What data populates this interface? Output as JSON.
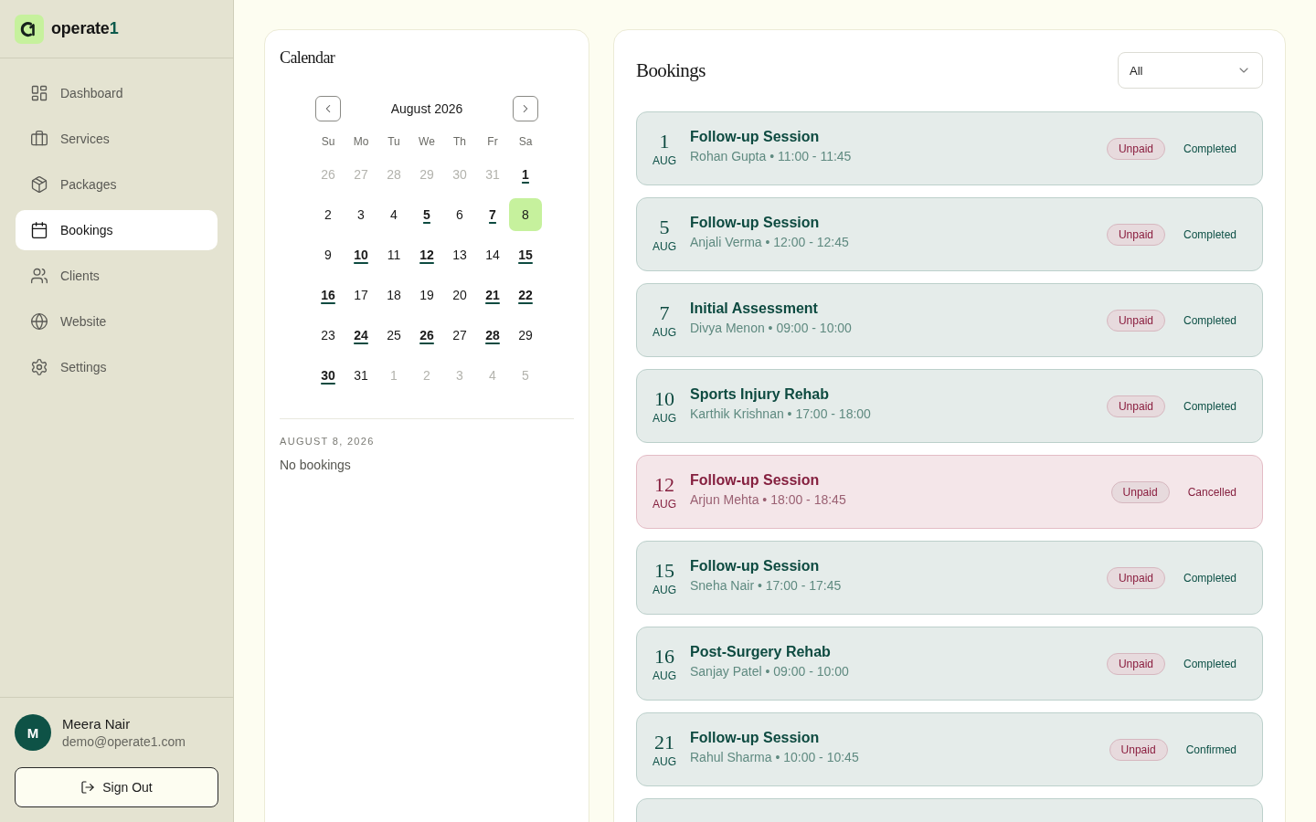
{
  "sidebar": {
    "brand": {
      "name": "operate",
      "accent": "1"
    },
    "items": [
      {
        "label": "Dashboard",
        "selected": false
      },
      {
        "label": "Services",
        "selected": false
      },
      {
        "label": "Packages",
        "selected": false
      },
      {
        "label": "Bookings",
        "selected": true
      },
      {
        "label": "Clients",
        "selected": false
      },
      {
        "label": "Website",
        "selected": false
      },
      {
        "label": "Settings",
        "selected": false
      }
    ],
    "user": {
      "initial": "M",
      "name": "Meera Nair",
      "email": "demo@operate1.com"
    },
    "sign_out": "Sign Out"
  },
  "calendar": {
    "title": "Calendar",
    "month": "August 2026",
    "weekdays": [
      "Su",
      "Mo",
      "Tu",
      "We",
      "Th",
      "Fr",
      "Sa"
    ],
    "days": [
      {
        "day": "26",
        "outside": true,
        "booked": false,
        "selected": false
      },
      {
        "day": "27",
        "outside": true,
        "booked": false,
        "selected": false
      },
      {
        "day": "28",
        "outside": true,
        "booked": false,
        "selected": false
      },
      {
        "day": "29",
        "outside": true,
        "booked": false,
        "selected": false
      },
      {
        "day": "30",
        "outside": true,
        "booked": false,
        "selected": false
      },
      {
        "day": "31",
        "outside": true,
        "booked": false,
        "selected": false
      },
      {
        "day": "1",
        "outside": false,
        "booked": true,
        "selected": false
      },
      {
        "day": "2",
        "outside": false,
        "booked": false,
        "selected": false
      },
      {
        "day": "3",
        "outside": false,
        "booked": false,
        "selected": false
      },
      {
        "day": "4",
        "outside": false,
        "booked": false,
        "selected": false
      },
      {
        "day": "5",
        "outside": false,
        "booked": true,
        "selected": false
      },
      {
        "day": "6",
        "outside": false,
        "booked": false,
        "selected": false
      },
      {
        "day": "7",
        "outside": false,
        "booked": true,
        "selected": false
      },
      {
        "day": "8",
        "outside": false,
        "booked": false,
        "selected": true
      },
      {
        "day": "9",
        "outside": false,
        "booked": false,
        "selected": false
      },
      {
        "day": "10",
        "outside": false,
        "booked": true,
        "selected": false
      },
      {
        "day": "11",
        "outside": false,
        "booked": false,
        "selected": false
      },
      {
        "day": "12",
        "outside": false,
        "booked": true,
        "selected": false
      },
      {
        "day": "13",
        "outside": false,
        "booked": false,
        "selected": false
      },
      {
        "day": "14",
        "outside": false,
        "booked": false,
        "selected": false
      },
      {
        "day": "15",
        "outside": false,
        "booked": true,
        "selected": false
      },
      {
        "day": "16",
        "outside": false,
        "booked": true,
        "selected": false
      },
      {
        "day": "17",
        "outside": false,
        "booked": false,
        "selected": false
      },
      {
        "day": "18",
        "outside": false,
        "booked": false,
        "selected": false
      },
      {
        "day": "19",
        "outside": false,
        "booked": false,
        "selected": false
      },
      {
        "day": "20",
        "outside": false,
        "booked": false,
        "selected": false
      },
      {
        "day": "21",
        "outside": false,
        "booked": true,
        "selected": false
      },
      {
        "day": "22",
        "outside": false,
        "booked": true,
        "selected": false
      },
      {
        "day": "23",
        "outside": false,
        "booked": false,
        "selected": false
      },
      {
        "day": "24",
        "outside": false,
        "booked": true,
        "selected": false
      },
      {
        "day": "25",
        "outside": false,
        "booked": false,
        "selected": false
      },
      {
        "day": "26",
        "outside": false,
        "booked": true,
        "selected": false
      },
      {
        "day": "27",
        "outside": false,
        "booked": false,
        "selected": false
      },
      {
        "day": "28",
        "outside": false,
        "booked": true,
        "selected": false
      },
      {
        "day": "29",
        "outside": false,
        "booked": false,
        "selected": false
      },
      {
        "day": "30",
        "outside": false,
        "booked": true,
        "selected": false
      },
      {
        "day": "31",
        "outside": false,
        "booked": false,
        "selected": false
      },
      {
        "day": "1",
        "outside": true,
        "booked": false,
        "selected": false
      },
      {
        "day": "2",
        "outside": true,
        "booked": false,
        "selected": false
      },
      {
        "day": "3",
        "outside": true,
        "booked": false,
        "selected": false
      },
      {
        "day": "4",
        "outside": true,
        "booked": false,
        "selected": false
      },
      {
        "day": "5",
        "outside": true,
        "booked": false,
        "selected": false
      }
    ],
    "selected_date": "AUGUST 8, 2026",
    "empty_text": "No bookings"
  },
  "bookings": {
    "title": "Bookings",
    "filter": {
      "value": "All"
    },
    "items": [
      {
        "kind": "active",
        "day": "1",
        "month": "AUG",
        "title": "Follow-up Session",
        "subtitle": "Rohan Gupta • 11:00 - 11:45",
        "payment": "Unpaid",
        "status": "Completed"
      },
      {
        "kind": "active",
        "day": "5",
        "month": "AUG",
        "title": "Follow-up Session",
        "subtitle": "Anjali Verma • 12:00 - 12:45",
        "payment": "Unpaid",
        "status": "Completed"
      },
      {
        "kind": "active",
        "day": "7",
        "month": "AUG",
        "title": "Initial Assessment",
        "subtitle": "Divya Menon • 09:00 - 10:00",
        "payment": "Unpaid",
        "status": "Completed"
      },
      {
        "kind": "active",
        "day": "10",
        "month": "AUG",
        "title": "Sports Injury Rehab",
        "subtitle": "Karthik Krishnan • 17:00 - 18:00",
        "payment": "Unpaid",
        "status": "Completed"
      },
      {
        "kind": "cancelled",
        "day": "12",
        "month": "AUG",
        "title": "Follow-up Session",
        "subtitle": "Arjun Mehta • 18:00 - 18:45",
        "payment": "Unpaid",
        "status": "Cancelled"
      },
      {
        "kind": "active",
        "day": "15",
        "month": "AUG",
        "title": "Follow-up Session",
        "subtitle": "Sneha Nair • 17:00 - 17:45",
        "payment": "Unpaid",
        "status": "Completed"
      },
      {
        "kind": "active",
        "day": "16",
        "month": "AUG",
        "title": "Post-Surgery Rehab",
        "subtitle": "Sanjay Patel • 09:00 - 10:00",
        "payment": "Unpaid",
        "status": "Completed"
      },
      {
        "kind": "active",
        "day": "21",
        "month": "AUG",
        "title": "Follow-up Session",
        "subtitle": "Rahul Sharma • 10:00 - 10:45",
        "payment": "Unpaid",
        "status": "Confirmed"
      },
      {
        "kind": "active"
      }
    ]
  }
}
